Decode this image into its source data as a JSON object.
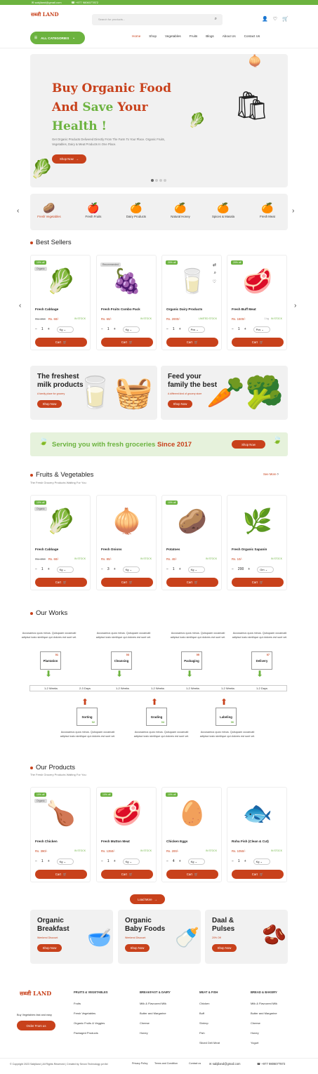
{
  "topbar": {
    "email": "sabjiland@gmail.com",
    "phone": "+977 9806077872"
  },
  "header": {
    "logo": "सब्जी LAND",
    "search_placeholder": "Search for products...",
    "categories_label": "ALL CATEGORIES",
    "nav": [
      "Home",
      "Shop",
      "Vegetables",
      "Fruits",
      "Blogs",
      "About Us",
      "Contact Us"
    ]
  },
  "hero": {
    "line1": "Buy Organic Food",
    "line2a": "And ",
    "line2b": "Save",
    "line2c": " Your",
    "line3": "Health !",
    "desc": "Get Organic Products Delivered Directly From The Farm To Your Place. Organic Fruits, Vegetables, Dairy & Meat Products In One Place.",
    "button": "Shop Now"
  },
  "categories": [
    "Fresh Vegetables",
    "Fresh Fruits",
    "Dairy Products",
    "Natural Honey",
    "Spices & Masala",
    "Fresh Meat"
  ],
  "best_sellers": {
    "title": "Best Sellers",
    "items": [
      {
        "name": "Fresh Cabbage",
        "old": "Rs. 250",
        "price": "Rs. 60/-",
        "stock": "IN STOCK",
        "qty": "1",
        "unit": "Kg",
        "badge": "10% off",
        "tag": "Organic",
        "cart": "Cart"
      },
      {
        "name": "Fresh Fruits Combo Pack",
        "old": "",
        "price": "Rs. 60/-",
        "stock": "IN STOCK",
        "qty": "1",
        "unit": "Kg",
        "badge": "",
        "tag": "Recommended",
        "cart": "Cart"
      },
      {
        "name": "Organic Dairy Products",
        "old": "",
        "price": "Rs. 2000/-",
        "stock": "LIMITED STOCK",
        "qty": "1",
        "unit": "Pcs",
        "badge": "20% off",
        "tag": "",
        "cart": "Cart"
      },
      {
        "name": "Fresh Buff Meat",
        "old": "",
        "price": "Rs. 1500/-",
        "stock": "IN STOCK",
        "qty": "1",
        "unit": "Pcs",
        "badge": "20% off",
        "tag": "",
        "cart": "Cart",
        "note": "1 kg"
      }
    ]
  },
  "promos1": [
    {
      "title": "The freshest milk products",
      "tag": "A family place for grocery",
      "button": "Shop Now"
    },
    {
      "title": "Feed your family the best",
      "tag": "A different kind of grocery store",
      "button": "Shop Now"
    }
  ],
  "banner": {
    "text": "Serving you with fresh groceries ",
    "year": "Since 2017",
    "button": "Shop Now"
  },
  "fruits_veg": {
    "title": "Fruits & Vegetables",
    "subtitle": "The Fresh Grocery Products Waiting For You",
    "see_more": "See More",
    "items": [
      {
        "name": "Fresh Cabbage",
        "old": "Rs. 250",
        "price": "Rs. 60/-",
        "stock": "IN STOCK",
        "qty": "1",
        "unit": "Kg",
        "badge": "10% off",
        "tag": "Organic",
        "cart": "Cart"
      },
      {
        "name": "Fresh Onions",
        "old": "",
        "price": "Rs. 80/-",
        "stock": "IN STOCK",
        "qty": "3",
        "unit": "Kg",
        "badge": "",
        "tag": "",
        "cart": "Cart"
      },
      {
        "name": "Potatoes",
        "old": "",
        "price": "Rs. 40/-",
        "stock": "IN STOCK",
        "qty": "1",
        "unit": "Kg",
        "badge": "10% off",
        "tag": "",
        "cart": "Cart"
      },
      {
        "name": "Fresh Organic Sapanin",
        "old": "",
        "price": "Rs. 10/-",
        "stock": "IN STOCK",
        "qty": "200",
        "unit": "Gm",
        "badge": "",
        "tag": "",
        "cart": "Cart"
      }
    ]
  },
  "works": {
    "title": "Our Works",
    "desc": "Accusamus quos minus. Quisquam occaecati adipisci iusto similique qui dolores est sunt vel.",
    "top": [
      {
        "label": "Plantation",
        "n": "01"
      },
      {
        "label": "Cleansing",
        "n": "03"
      },
      {
        "label": "Packaging",
        "n": "05"
      },
      {
        "label": "Delivery",
        "n": "07"
      }
    ],
    "bottom": [
      {
        "label": "Sorting",
        "n": "02"
      },
      {
        "label": "Grading",
        "n": "04"
      },
      {
        "label": "Labeling",
        "n": "06"
      }
    ],
    "timeline": [
      "1-2 Weeks",
      "2-3 Days",
      "1-2 Weeks",
      "1-2 Weeks",
      "1-2 Weeks",
      "1-2 Weeks",
      "1-2 Days"
    ]
  },
  "products": {
    "title": "Our Products",
    "subtitle": "The Fresh Grocery Products Waiting For You",
    "load_more": "Load More",
    "items": [
      {
        "name": "Fresh Chicken",
        "old": "",
        "price": "Rs. 390/-",
        "stock": "IN STOCK",
        "qty": "1",
        "unit": "Kg",
        "badge": "10% off",
        "tag": "Organic",
        "cart": "Cart"
      },
      {
        "name": "Fresh Mutton Meat",
        "old": "",
        "price": "Rs. 1350/-",
        "stock": "IN STOCK",
        "qty": "1",
        "unit": "Kg",
        "badge": "10% off",
        "tag": "",
        "cart": "Cart"
      },
      {
        "name": "Chicken Eggs",
        "old": "",
        "price": "Rs. 200/-",
        "stock": "IN STOCK",
        "qty": "4",
        "unit": "Kg",
        "badge": "10% off",
        "tag": "",
        "cart": "Cart"
      },
      {
        "name": "Rohu Fish (Clean & Cut)",
        "old": "",
        "price": "Rs. 1050/-",
        "stock": "IN STOCK",
        "qty": "1",
        "unit": "Kg",
        "badge": "",
        "tag": "",
        "cart": "Cart"
      }
    ]
  },
  "promos2": [
    {
      "title": "Organic Breakfast",
      "tag": "Weekend Discount",
      "button": "Shop Now"
    },
    {
      "title": "Organic Baby Foods",
      "tag": "Weekend Discount",
      "button": "Shop Now"
    },
    {
      "title": "Daal & Pulses",
      "tag": "20% Off",
      "button": "Shop Now"
    }
  ],
  "footer": {
    "tagline": "Buy Vegetables fast and easy",
    "order": "Order From us",
    "cols": [
      {
        "h": "FRUITS & VEGETABLES",
        "items": [
          "Fruits",
          "Fresh Vegetables",
          "Organic Fruits & Veggies",
          "Packaged Products"
        ]
      },
      {
        "h": "BREAKFAST & DAIRY",
        "items": [
          "Milk & Flavoured Milk",
          "Butter and Margarine",
          "Cheese",
          "Honey"
        ]
      },
      {
        "h": "MEAT & FISH",
        "items": [
          "Chicken",
          "Buff",
          "Shrimp",
          "Fish",
          "Sliced Deli Meat"
        ]
      },
      {
        "h": "BREAD & BAKERY",
        "items": [
          "Milk & Flavoured Milk",
          "Butter and Margarine",
          "Cheese",
          "Honey",
          "Yogurt"
        ]
      }
    ],
    "copyright": "© Copyright 2023 Sabjiland | All Rights Reserved | Created by Sevon Technology pvt.ltd",
    "privacy": "Privacy Policy",
    "terms": "Terms and Condition",
    "contact": "Contact us",
    "email": "sabjiland@gmail.com",
    "phone": "+977 9806077872"
  }
}
